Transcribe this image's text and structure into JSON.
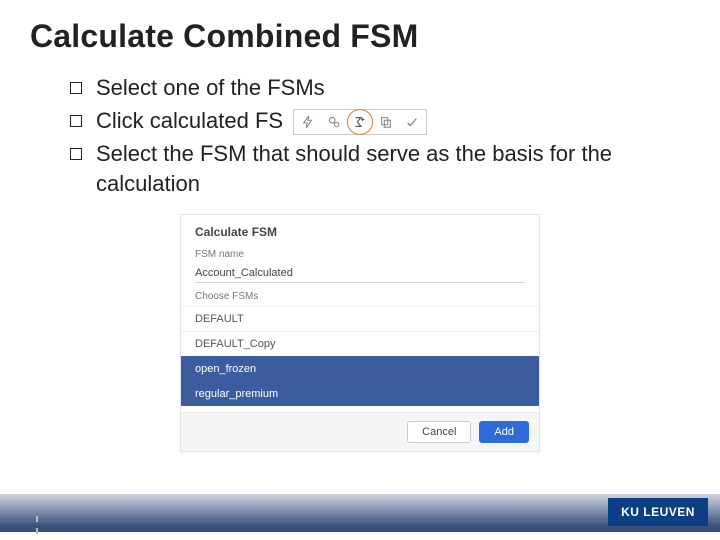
{
  "title": "Calculate Combined FSM",
  "bullets": {
    "b1": "Select one of the FSMs",
    "b2_pre": "Click calculated FS",
    "b3": "Select the FSM that should serve as the basis for the calculation"
  },
  "toolbar": {
    "icon1": "lightning-icon",
    "icon2": "gears-icon",
    "icon3": "sigma-plus-icon",
    "icon4": "copy-icon",
    "icon5": "check-icon"
  },
  "dialog": {
    "title": "Calculate FSM",
    "name_label": "FSM name",
    "name_value": "Account_Calculated",
    "choose_label": "Choose FSMs",
    "items": [
      {
        "label": "DEFAULT",
        "selected": false
      },
      {
        "label": "DEFAULT_Copy",
        "selected": false
      },
      {
        "label": "open_frozen",
        "selected": true
      },
      {
        "label": "regular_premium",
        "selected": true
      }
    ],
    "cancel": "Cancel",
    "add": "Add"
  },
  "branding": {
    "kuleuven": "KU LEUVEN"
  }
}
